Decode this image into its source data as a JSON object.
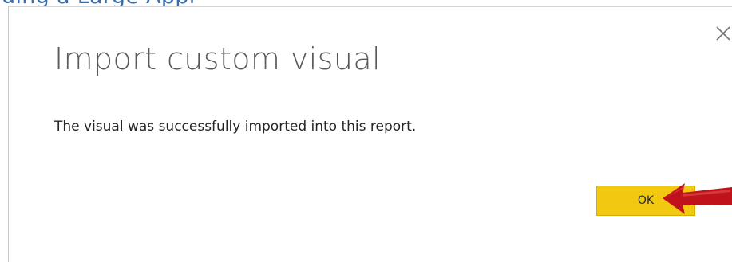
{
  "background": {
    "partial_text": "ding a Large Appl",
    "text_color": "#3b6dab"
  },
  "dialog": {
    "title": "Import custom visual",
    "message": "The visual was successfully imported into this report.",
    "ok_label": "OK",
    "close_icon": "close-icon"
  },
  "annotation": {
    "arrow_icon": "red-arrow-icon",
    "arrow_color": "#c0121a"
  },
  "colors": {
    "ok_button": "#f2c811",
    "title_text": "#5a5a5a",
    "message_text": "#252525"
  }
}
